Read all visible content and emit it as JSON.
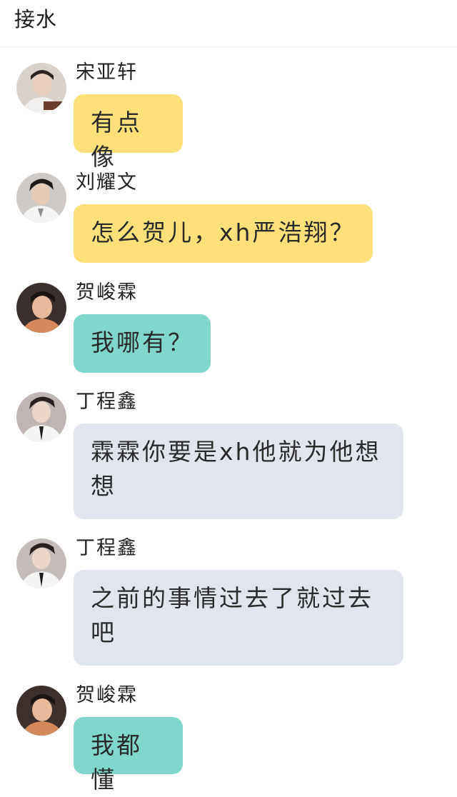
{
  "header": {
    "title": "接水"
  },
  "colors": {
    "yellow_bubble": "#fde07a",
    "teal_bubble": "#7fd8cb",
    "gray_bubble": "#e1e5ee"
  },
  "messages": [
    {
      "sender": "宋亚轩",
      "text": "有点像",
      "bubble_color": "yellow"
    },
    {
      "sender": "刘耀文",
      "text": "怎么贺儿，xh严浩翔？",
      "bubble_color": "yellow"
    },
    {
      "sender": "贺峻霖",
      "text": "我哪有？",
      "bubble_color": "teal"
    },
    {
      "sender": "丁程鑫",
      "text": "霖霖你要是xh他就为他想想",
      "bubble_color": "gray"
    },
    {
      "sender": "丁程鑫",
      "text": "之前的事情过去了就过去吧",
      "bubble_color": "gray"
    },
    {
      "sender": "贺峻霖",
      "text": "我都懂",
      "bubble_color": "teal"
    }
  ]
}
